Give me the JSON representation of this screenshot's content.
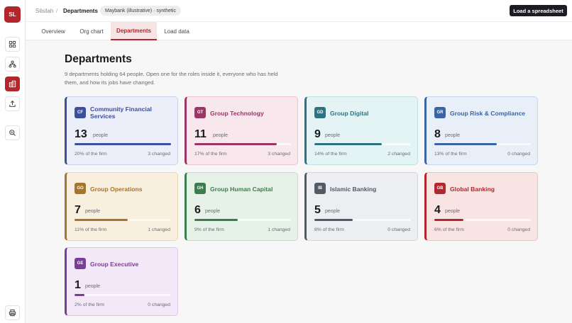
{
  "app": {
    "logo_initials": "SL",
    "breadcrumb": {
      "root": "Silsilah",
      "separator": "/",
      "current": "Departments"
    },
    "dataset_badge": "Maybank (illustrative) · synthetic",
    "load_button": "Load a spreadsheet"
  },
  "rail": {
    "items": [
      {
        "name": "overview",
        "icon": "grid-icon"
      },
      {
        "name": "org-chart",
        "icon": "org-chart-icon"
      },
      {
        "name": "departments",
        "icon": "buildings-icon",
        "active": true
      },
      {
        "name": "load-data",
        "icon": "upload-icon"
      },
      {
        "name": "search",
        "icon": "search-icon"
      },
      {
        "name": "print",
        "icon": "printer-icon"
      }
    ]
  },
  "tabs": [
    {
      "label": "Overview"
    },
    {
      "label": "Org chart"
    },
    {
      "label": "Departments",
      "active": true
    },
    {
      "label": "Load data"
    }
  ],
  "page": {
    "title": "Departments",
    "description": "9 departments holding 64 people. Open one for the roles inside it, everyone who has held them, and how its jobs have changed."
  },
  "people_label": "people",
  "departments": [
    {
      "code": "CF",
      "name": "Community Financial Services",
      "count": "13",
      "share": "20% of the firm",
      "share_value": 0.2,
      "changed": "3 changed",
      "color": "#3b4f9c",
      "bg": "#eceff9",
      "border": "#c9d1ee"
    },
    {
      "code": "GT",
      "name": "Group Technology",
      "count": "11",
      "share": "17% of the firm",
      "share_value": 0.17,
      "changed": "3 changed",
      "color": "#9b3566",
      "bg": "#f9e7ee",
      "border": "#eec3d4"
    },
    {
      "code": "GD",
      "name": "Group Digital",
      "count": "9",
      "share": "14% of the firm",
      "share_value": 0.14,
      "changed": "2 changed",
      "color": "#2f7380",
      "bg": "#e4f3f4",
      "border": "#bfe0e3"
    },
    {
      "code": "GR",
      "name": "Group Risk & Compliance",
      "count": "8",
      "share": "13% of the firm",
      "share_value": 0.13,
      "changed": "0 changed",
      "color": "#3a64a3",
      "bg": "#e8eff9",
      "border": "#c6d6ee"
    },
    {
      "code": "GO",
      "name": "Group Operations",
      "count": "7",
      "share": "11% of the firm",
      "share_value": 0.11,
      "changed": "1 changed",
      "color": "#a6742a",
      "bg": "#f8efdf",
      "border": "#ecd6b0"
    },
    {
      "code": "GH",
      "name": "Group Human Capital",
      "count": "6",
      "share": "9% of the firm",
      "share_value": 0.09,
      "changed": "1 changed",
      "color": "#3c7d4d",
      "bg": "#e6f2e8",
      "border": "#c2e0c8"
    },
    {
      "code": "IB",
      "name": "Islamic Banking",
      "count": "5",
      "share": "8% of the firm",
      "share_value": 0.08,
      "changed": "0 changed",
      "color": "#525a66",
      "bg": "#eceef1",
      "border": "#d2d6dc"
    },
    {
      "code": "GB",
      "name": "Global Banking",
      "count": "4",
      "share": "6% of the firm",
      "share_value": 0.06,
      "changed": "0 changed",
      "color": "#b3262b",
      "bg": "#f9e4e4",
      "border": "#eec2c3"
    },
    {
      "code": "GE",
      "name": "Group Executive",
      "count": "1",
      "share": "2% of the firm",
      "share_value": 0.02,
      "changed": "0 changed",
      "color": "#7a3d98",
      "bg": "#f3e8f8",
      "border": "#dcc6ea"
    }
  ]
}
